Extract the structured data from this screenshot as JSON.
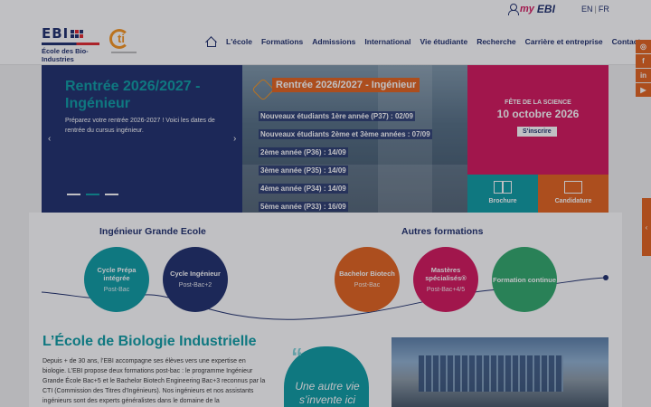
{
  "topbar": {
    "myebi_my": "my",
    "myebi_ebi": "EBI",
    "lang_en": "EN",
    "lang_sep": "|",
    "lang_fr": "FR"
  },
  "logo": {
    "ebi": "EBI",
    "line1": "École des Bio-",
    "line2": "Industries",
    "cti": "ti"
  },
  "nav": {
    "items": [
      "L'école",
      "Formations",
      "Admissions",
      "International",
      "Vie étudiante",
      "Recherche",
      "Carrière et entreprise",
      "Contact"
    ]
  },
  "social": [
    "◎",
    "f",
    "in",
    "▶"
  ],
  "side_tab_icon": "‹",
  "hero": {
    "title": "Rentrée 2026/2027 - Ingénieur",
    "desc": "Préparez votre rentrée 2026-2027 ! Voici les dates de rentrée du cursus ingénieur.",
    "prev": "‹",
    "next": "›",
    "photo_heading": "Rentrée 2026/2027 - Ingénieur",
    "photo_lines": [
      "Nouveaux étudiants 1ère année (P37) : 02/09",
      "Nouveaux étudiants 2ème et 3ème années : 07/09",
      "2ème année (P36) : 14/09",
      "3ème année (P35) : 14/09",
      "4ème année (P34) : 14/09",
      "5ème année (P33) : 16/09"
    ],
    "pink_label": "FÊTE DE LA SCIENCE",
    "pink_date": "10 octobre 2026",
    "pink_button": "S'inscrire",
    "tile_brochure": "Brochure",
    "tile_candidature": "Candidature"
  },
  "formations": {
    "left_title": "Ingénieur Grande Ecole",
    "right_title": "Autres formations",
    "circles": [
      {
        "title": "Cycle Prépa intégrée",
        "sub": "Post-Bac",
        "color": "#0a9ba3"
      },
      {
        "title": "Cycle Ingénieur",
        "sub": "Post-Bac+2",
        "color": "#1d2d6b"
      },
      {
        "title": "Bachelor Biotech",
        "sub": "Post-Bac",
        "color": "#e3621b"
      },
      {
        "title": "Mastères spécialisés®",
        "sub": "Post-Bac+4/5",
        "color": "#d4145a"
      },
      {
        "title": "Formation continue",
        "sub": "",
        "color": "#2ea86a"
      }
    ]
  },
  "about": {
    "title": "L’École de Biologie Industrielle",
    "text": "Depuis + de 30 ans, l’EBI accompagne ses élèves vers une expertise en biologie. L’EBI propose deux formations post-bac : le programme Ingénieur Grande École Bac+5 et le Bachelor Biotech Engineering Bac+3 reconnus par la CTI (Commission des Titres d’Ingénieurs). Nos ingénieurs et nos assistants ingénieurs sont des experts généralistes dans le domaine de la",
    "quote_mark": "“",
    "quote": "Une autre vie s’invente ici"
  },
  "colors": {
    "navy": "#1d2d6b",
    "teal": "#0a9ba3",
    "orange": "#e3621b",
    "pink": "#d4145a",
    "green": "#2ea86a"
  }
}
